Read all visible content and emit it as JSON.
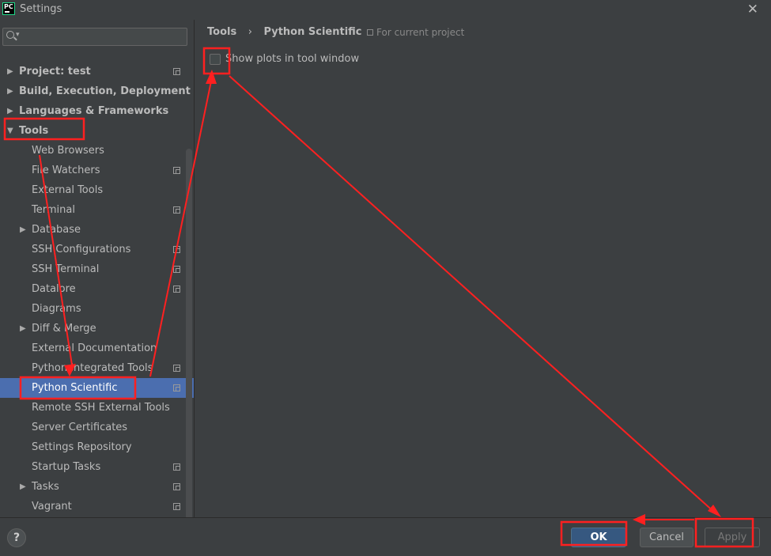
{
  "window": {
    "app_icon_text": "PC",
    "title": "Settings",
    "close_glyph": "✕"
  },
  "sidebar": {
    "search_placeholder": "",
    "items": [
      {
        "label": "Project: test",
        "level": 0,
        "expander": "collapsed",
        "bold": true,
        "copy_icon": true
      },
      {
        "label": "Build, Execution, Deployment",
        "level": 0,
        "expander": "collapsed",
        "bold": true,
        "copy_icon": false
      },
      {
        "label": "Languages & Frameworks",
        "level": 0,
        "expander": "collapsed",
        "bold": true,
        "copy_icon": false
      },
      {
        "label": "Tools",
        "level": 0,
        "expander": "expanded",
        "bold": true,
        "copy_icon": false
      },
      {
        "label": "Web Browsers",
        "level": 1,
        "expander": "none",
        "bold": false,
        "copy_icon": false
      },
      {
        "label": "File Watchers",
        "level": 1,
        "expander": "none",
        "bold": false,
        "copy_icon": true
      },
      {
        "label": "External Tools",
        "level": 1,
        "expander": "none",
        "bold": false,
        "copy_icon": false
      },
      {
        "label": "Terminal",
        "level": 1,
        "expander": "none",
        "bold": false,
        "copy_icon": true
      },
      {
        "label": "Database",
        "level": 1,
        "expander": "collapsed",
        "bold": false,
        "copy_icon": false
      },
      {
        "label": "SSH Configurations",
        "level": 1,
        "expander": "none",
        "bold": false,
        "copy_icon": true
      },
      {
        "label": "SSH Terminal",
        "level": 1,
        "expander": "none",
        "bold": false,
        "copy_icon": true
      },
      {
        "label": "Datalore",
        "level": 1,
        "expander": "none",
        "bold": false,
        "copy_icon": true
      },
      {
        "label": "Diagrams",
        "level": 1,
        "expander": "none",
        "bold": false,
        "copy_icon": false
      },
      {
        "label": "Diff & Merge",
        "level": 1,
        "expander": "collapsed",
        "bold": false,
        "copy_icon": false
      },
      {
        "label": "External Documentation",
        "level": 1,
        "expander": "none",
        "bold": false,
        "copy_icon": false
      },
      {
        "label": "Python Integrated Tools",
        "level": 1,
        "expander": "none",
        "bold": false,
        "copy_icon": true
      },
      {
        "label": "Python Scientific",
        "level": 1,
        "expander": "none",
        "bold": false,
        "copy_icon": true,
        "selected": true
      },
      {
        "label": "Remote SSH External Tools",
        "level": 1,
        "expander": "none",
        "bold": false,
        "copy_icon": false
      },
      {
        "label": "Server Certificates",
        "level": 1,
        "expander": "none",
        "bold": false,
        "copy_icon": false
      },
      {
        "label": "Settings Repository",
        "level": 1,
        "expander": "none",
        "bold": false,
        "copy_icon": false
      },
      {
        "label": "Startup Tasks",
        "level": 1,
        "expander": "none",
        "bold": false,
        "copy_icon": true
      },
      {
        "label": "Tasks",
        "level": 1,
        "expander": "collapsed",
        "bold": false,
        "copy_icon": true
      },
      {
        "label": "Vagrant",
        "level": 1,
        "expander": "none",
        "bold": false,
        "copy_icon": true
      }
    ]
  },
  "main": {
    "breadcrumb": [
      "Tools",
      "Python Scientific"
    ],
    "breadcrumb_sep": "›",
    "scope_note": "For current project",
    "show_plots_label": "Show plots in tool window",
    "show_plots_checked": false
  },
  "footer": {
    "help_label": "?",
    "ok_label": "OK",
    "cancel_label": "Cancel",
    "apply_label": "Apply"
  },
  "colors": {
    "background": "#3c3f41",
    "selection": "#4b6eaf",
    "annotation": "#ff2020",
    "ok_button": "#365880"
  },
  "icons": [
    "pycharm-icon",
    "close-icon",
    "search-icon",
    "copy-icon",
    "help-icon"
  ]
}
